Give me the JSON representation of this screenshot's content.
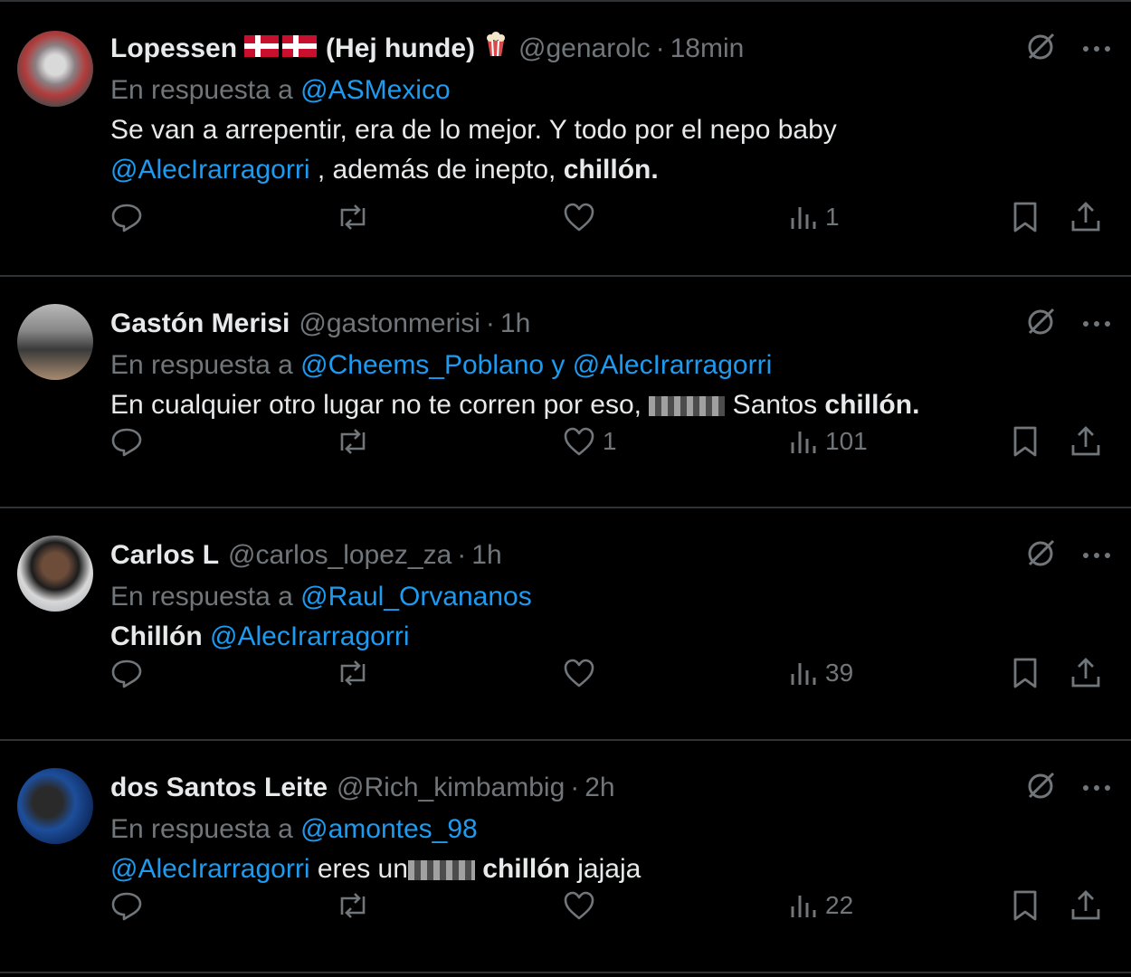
{
  "tweets": [
    {
      "name": "Lopessen",
      "name_suffix": "(Hej hunde)",
      "flags": [
        "flag-denmark",
        "flag-denmark"
      ],
      "emoji": "popcorn-emoji",
      "handle": "@genarolc",
      "time": "18min",
      "reply_prefix": "En respuesta a",
      "reply_to": "@ASMexico",
      "text_parts": [
        {
          "t": "Se van a arrepentir, era de lo mejor. Y todo por el nepo baby",
          "style": "normal"
        },
        {
          "t": "@AlecIrarragorri",
          "style": "link"
        },
        {
          "t": " , además de inepto, ",
          "style": "normal"
        },
        {
          "t": "chillón.",
          "style": "bold"
        }
      ],
      "replies": "",
      "retweets": "",
      "likes": "",
      "views": "1"
    },
    {
      "name": "Gastón Merisi",
      "handle": "@gastonmerisi",
      "time": "1h",
      "reply_prefix": "En respuesta a",
      "reply_to": "@Cheems_Poblano y @AlecIrarragorri",
      "text_parts": [
        {
          "t": "En cualquier otro lugar no te corren por eso, ",
          "style": "normal"
        },
        {
          "t": "",
          "style": "censored"
        },
        {
          "t": " Santos ",
          "style": "normal"
        },
        {
          "t": "chillón.",
          "style": "bold"
        }
      ],
      "replies": "",
      "retweets": "",
      "likes": "1",
      "views": "101"
    },
    {
      "name": "Carlos L",
      "handle": "@carlos_lopez_za",
      "time": "1h",
      "reply_prefix": "En respuesta a",
      "reply_to": "@Raul_Orvananos",
      "text_parts": [
        {
          "t": "Chillón",
          "style": "bold"
        },
        {
          "t": " ",
          "style": "normal"
        },
        {
          "t": "@AlecIrarragorri",
          "style": "link"
        }
      ],
      "replies": "",
      "retweets": "",
      "likes": "",
      "views": "39"
    },
    {
      "name": "dos Santos Leite",
      "handle": "@Rich_kimbambig",
      "time": "2h",
      "reply_prefix": "En respuesta a",
      "reply_to": "@amontes_98",
      "text_parts": [
        {
          "t": "@AlecIrarragorri",
          "style": "link"
        },
        {
          "t": " eres un",
          "style": "normal"
        },
        {
          "t": "",
          "style": "censored"
        },
        {
          "t": " chillón",
          "style": "bold"
        },
        {
          "t": " jajaja",
          "style": "normal"
        }
      ],
      "replies": "",
      "retweets": "",
      "likes": "",
      "views": "22"
    }
  ],
  "icons": {
    "grok": "grok-icon",
    "more": "more-icon",
    "reply": "reply-icon",
    "retweet": "retweet-icon",
    "like": "like-icon",
    "views": "views-icon",
    "bookmark": "bookmark-icon",
    "share": "share-icon"
  },
  "colors": {
    "background": "#000000",
    "text": "#e7e9ea",
    "muted": "#71767b",
    "link": "#1d9bf0",
    "divider": "#2f3336"
  }
}
